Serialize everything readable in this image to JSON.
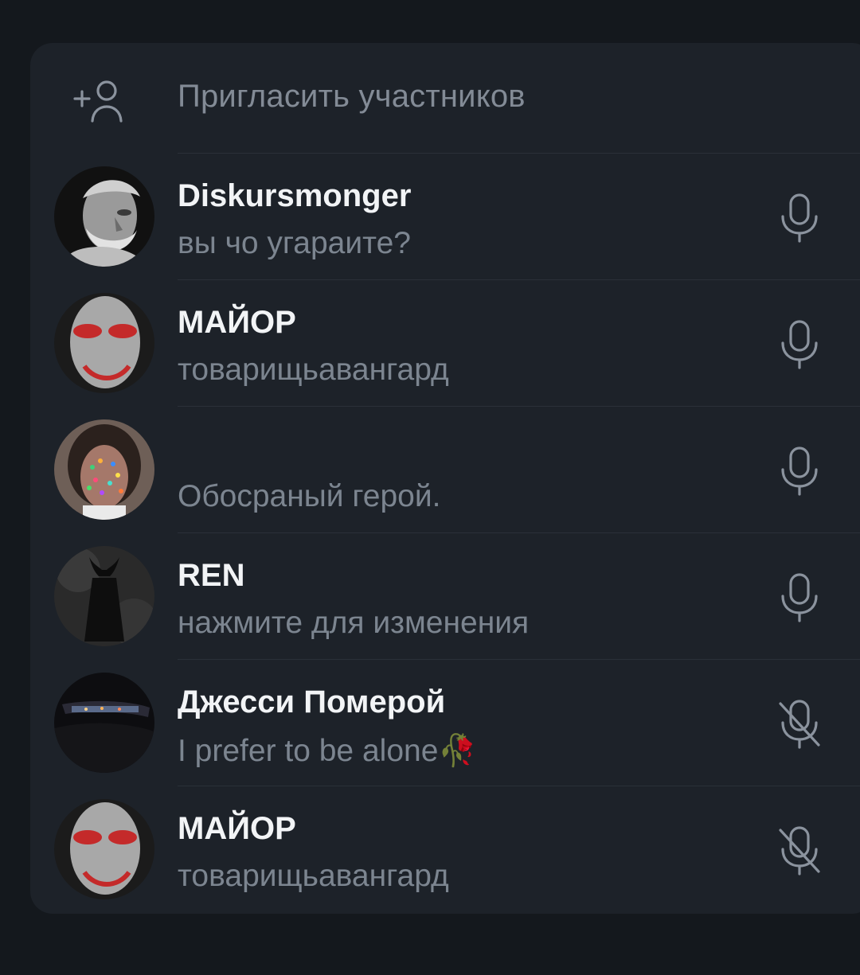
{
  "invite": {
    "label": "Пригласить участников",
    "icon": "add-user-icon"
  },
  "members": [
    {
      "name": "Diskursmonger",
      "status": "вы чо угараите?",
      "mic": "mic-icon",
      "muted": false,
      "avatar": "statue-avatar"
    },
    {
      "name": "МАЙОР",
      "status": "товарищьавангард",
      "mic": "mic-icon",
      "muted": false,
      "avatar": "face-mask-avatar"
    },
    {
      "name": "",
      "status": "Обосраный герой.",
      "mic": "mic-icon",
      "muted": false,
      "avatar": "face-dots-avatar"
    },
    {
      "name": "REN",
      "status": "нажмите для изменения",
      "mic": "mic-icon",
      "muted": false,
      "avatar": "dark-figure-avatar"
    },
    {
      "name": "Джесси Померой",
      "status": "I prefer to be alone🥀",
      "mic": "mic-off-icon",
      "muted": true,
      "avatar": "car-night-avatar"
    },
    {
      "name": "МАЙОР",
      "status": "товарищьавангард",
      "mic": "mic-off-icon",
      "muted": true,
      "avatar": "face-mask-avatar"
    }
  ],
  "colors": {
    "background": "#14181d",
    "panel": "#1d2229",
    "name_text": "#f2f4f6",
    "secondary_text": "#7c8590",
    "icon": "#8b939e"
  }
}
